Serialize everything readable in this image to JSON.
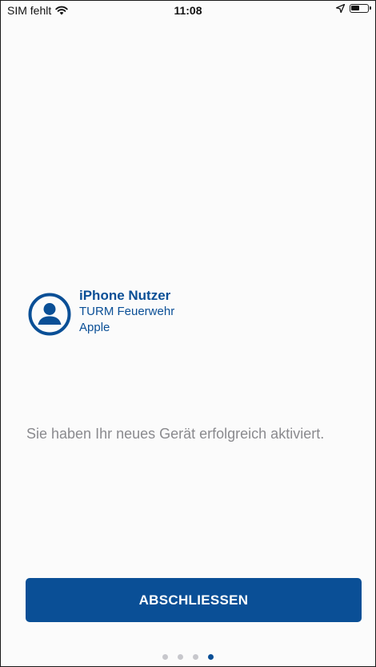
{
  "status_bar": {
    "carrier": "SIM fehlt",
    "time": "11:08",
    "icons": [
      "wifi-icon",
      "location-icon",
      "battery-icon"
    ]
  },
  "user": {
    "name": "iPhone Nutzer",
    "organization": "TURM Feuerwehr",
    "device": "Apple",
    "icon": "user-circle-icon"
  },
  "message": "Sie haben Ihr neues Gerät erfolgreich aktiviert.",
  "finish_button": {
    "label": "ABSCHLIESSEN"
  },
  "pager": {
    "total": 4,
    "current": 4
  },
  "colors": {
    "accent": "#0a4f96",
    "muted_text": "#8a8a8e",
    "dot_inactive": "#c7c7cc"
  }
}
